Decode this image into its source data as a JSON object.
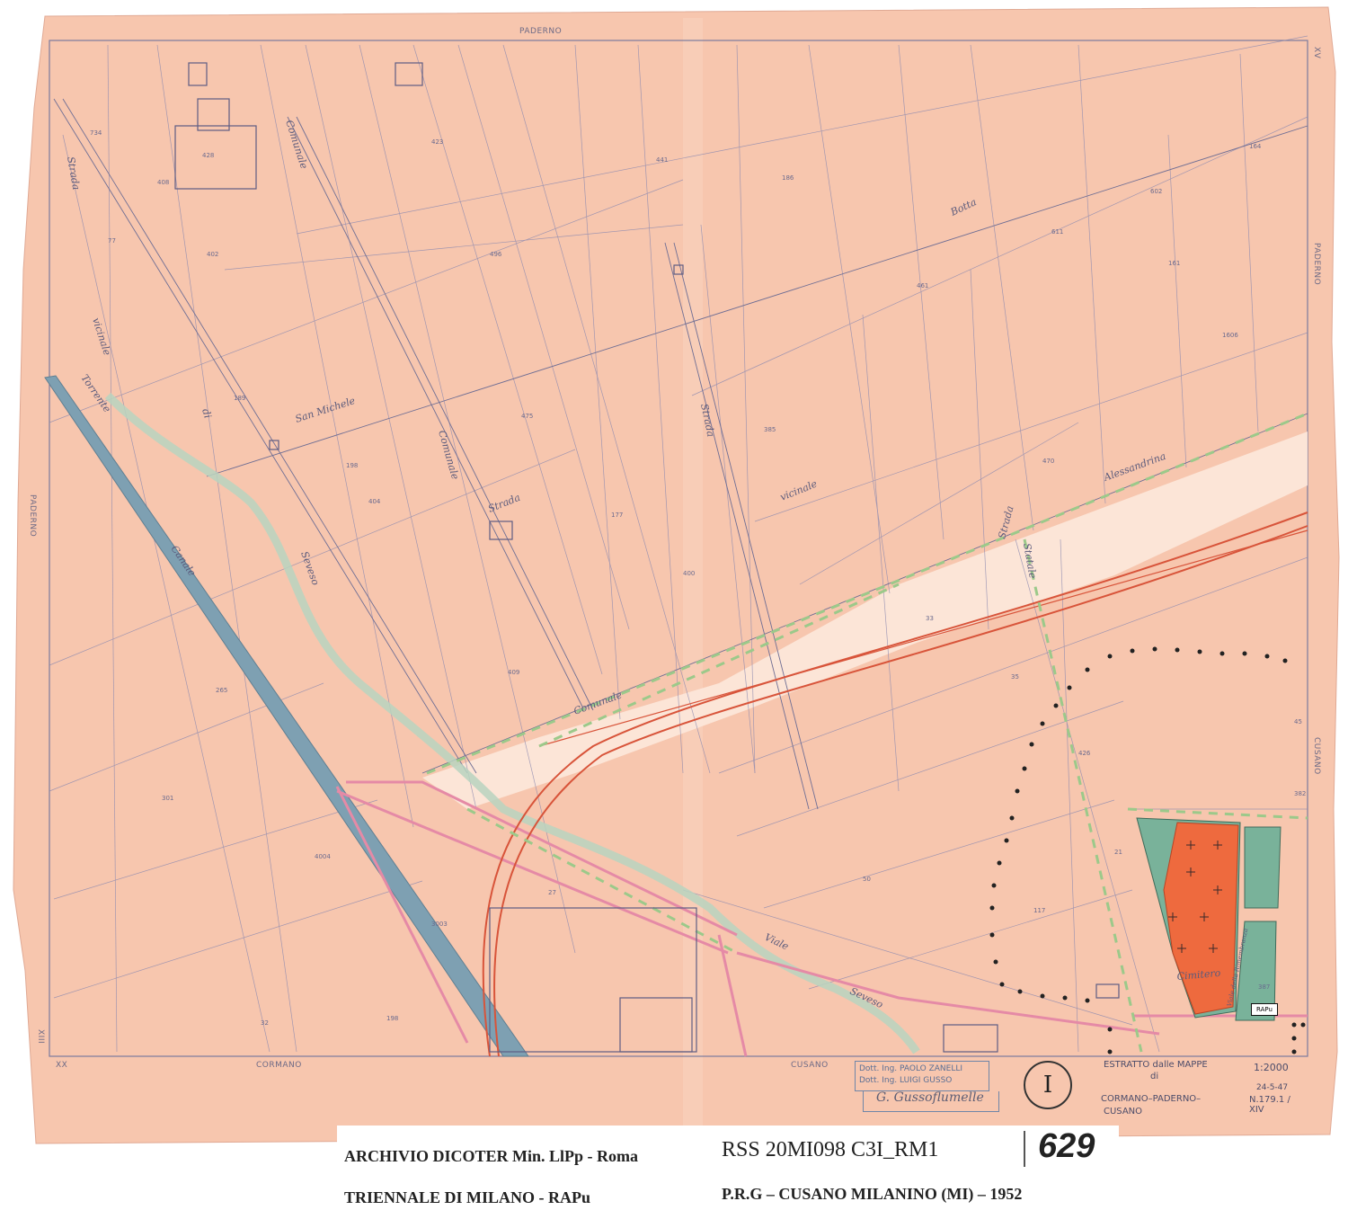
{
  "map": {
    "edge_labels": {
      "top": "PADERNO",
      "left": "PADERNO",
      "right_top": "PADERNO",
      "right_bottom": "CUSANO",
      "bottom_left": "CORMANO",
      "bottom_right": "CUSANO",
      "corner_tl": "XX",
      "corner_tr": "XV",
      "corner_bl": "XIII",
      "corner_br": "XIV"
    },
    "road_labels": [
      "Strada",
      "Comunale",
      "vicinale",
      "di",
      "San Michele",
      "Torrente",
      "Seveso",
      "Strada",
      "Comunale",
      "Strada",
      "vicinale",
      "Strada",
      "Statale",
      "Botta",
      "Alessandrina",
      "Comunale",
      "Viale",
      "Seveso",
      "Cimitero",
      "Viale della Rimembranza",
      "Canale"
    ],
    "stamp": {
      "line1": "Dott. Ing. PAOLO ZANELLI",
      "line2": "Dott. Ing. LUIGI GUSSO"
    },
    "signature": "G. Gussoflumelle",
    "sheet_label": "I",
    "title_block": {
      "line1": "ESTRATTO dalle MAPPE",
      "line2": "di",
      "line3": "CORMANO–PADERNO–",
      "line4": "CUSANO",
      "scale": "1:2000",
      "date": "24-5-47",
      "number": "N.179.1 / XIV"
    },
    "rapu_tag": "RAPu",
    "colors": {
      "paper": "#f7c6ae",
      "line": "#7a7b9e",
      "canal": "#7ea0b2",
      "rail": "#d8543a",
      "pink_road": "#e58aa6",
      "green_zone": "#79b29a",
      "cemetery_red": "#ee6a3e",
      "green_dash": "#9cc98a"
    }
  },
  "caption": {
    "archive_line1": "ARCHIVIO DICOTER Min. LlPp - Roma",
    "archive_line2": "TRIENNALE DI MILANO - RAPu",
    "code": "RSS 20MI098 C3I_RM1",
    "number": "629",
    "plan": "P.R.G – CUSANO MILANINO (MI) – 1952"
  }
}
